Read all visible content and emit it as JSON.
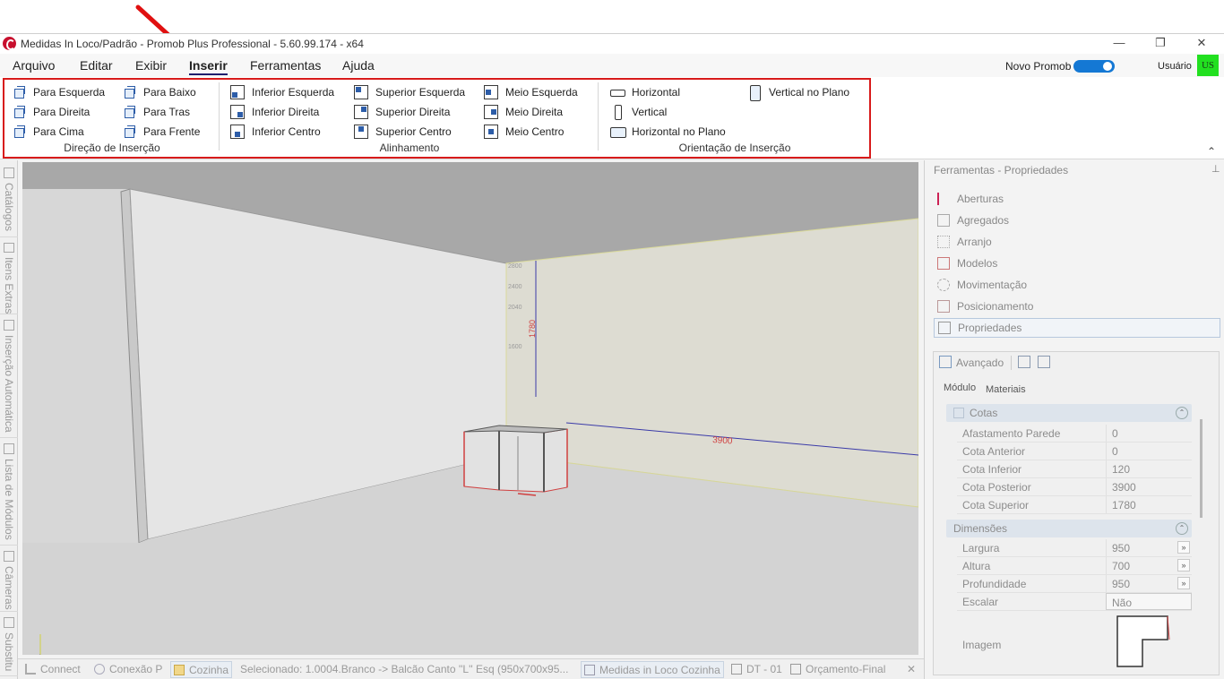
{
  "window": {
    "title": "Medidas In Loco/Padrão - Promob Plus Professional - 5.60.99.174 - x64",
    "minimize": "—",
    "restore": "❐",
    "close": "✕"
  },
  "menubar": {
    "items": [
      {
        "label": "Arquivo"
      },
      {
        "label": "Editar"
      },
      {
        "label": "Exibir"
      },
      {
        "label": "Inserir",
        "active": true
      },
      {
        "label": "Ferramentas"
      },
      {
        "label": "Ajuda"
      }
    ],
    "novo_promob_label": "Novo Promob",
    "novo_promob_toggle": "on",
    "usuario_label": "Usuário",
    "user_badge": "US",
    "user_badge_color": "#22e020",
    "collapse_glyph": "⌃"
  },
  "annotation": {
    "arrow_color": "#e01010"
  },
  "ribbon": {
    "outline_color": "#d81b1b",
    "direcao": {
      "label": "Direção de Inserção",
      "buttons": [
        "Para Esquerda",
        "Para Direita",
        "Para Cima",
        "Para Baixo",
        "Para Tras",
        "Para Frente"
      ]
    },
    "alinhamento": {
      "label": "Alinhamento",
      "buttons": [
        "Inferior Esquerda",
        "Inferior Direita",
        "Inferior Centro",
        "Superior Esquerda",
        "Superior Direita",
        "Superior Centro",
        "Meio Esquerda",
        "Meio Direita",
        "Meio Centro"
      ]
    },
    "orientacao": {
      "label": "Orientação de Inserção",
      "buttons": [
        "Horizontal",
        "Vertical",
        "Horizontal no Plano",
        "Vertical no Plano"
      ]
    }
  },
  "leftbar": {
    "tabs": [
      "Catálogos",
      "Itens Extras",
      "Inserção Automática",
      "Lista de Módulos",
      "Câmeras",
      "Substitu"
    ]
  },
  "viewport": {
    "dim_vertical": "1780",
    "dim_horizontal": "3900",
    "wall_ticks": [
      "2800",
      "2400",
      "2040",
      "1600"
    ]
  },
  "rightpanel": {
    "title": "Ferramentas - Propriedades",
    "pin": "⊥",
    "tools": [
      {
        "label": "Aberturas",
        "icon": "flag-icon"
      },
      {
        "label": "Agregados",
        "icon": "aggregate-icon"
      },
      {
        "label": "Arranjo",
        "icon": "grid-icon"
      },
      {
        "label": "Modelos",
        "icon": "model-icon"
      },
      {
        "label": "Movimentação",
        "icon": "move-icon"
      },
      {
        "label": "Posicionamento",
        "icon": "position-icon"
      },
      {
        "label": "Propriedades",
        "icon": "properties-icon",
        "selected": true
      }
    ],
    "avancado_label": "Avançado",
    "subtabs": [
      "Módulo",
      "Materiais"
    ],
    "cotas": {
      "label": "Cotas",
      "rows": [
        {
          "label": "Afastamento Parede",
          "value": "0"
        },
        {
          "label": "Cota Anterior",
          "value": "0"
        },
        {
          "label": "Cota Inferior",
          "value": "120"
        },
        {
          "label": "Cota Posterior",
          "value": "3900"
        },
        {
          "label": "Cota Superior",
          "value": "1780"
        }
      ]
    },
    "dimensoes": {
      "label": "Dimensões",
      "rows": [
        {
          "label": "Largura",
          "value": "950"
        },
        {
          "label": "Altura",
          "value": "700"
        },
        {
          "label": "Profundidade",
          "value": "950"
        },
        {
          "label": "Escalar",
          "value": "Não"
        }
      ]
    },
    "imagem_label": "Imagem",
    "expand_glyph": "»",
    "collapse_glyph": "⌃"
  },
  "statusbar": {
    "connect": "Connect",
    "conexao": "Conexão P",
    "cozinha": "Cozinha",
    "selection": "Selecionado: 1.0004.Branco -> Balcão Canto ''L'' Esq (950x700x95...",
    "project": "Medidas in Loco Cozinha",
    "dt": "DT - 01",
    "orcamento": "Orçamento-Final",
    "close": "✕"
  }
}
